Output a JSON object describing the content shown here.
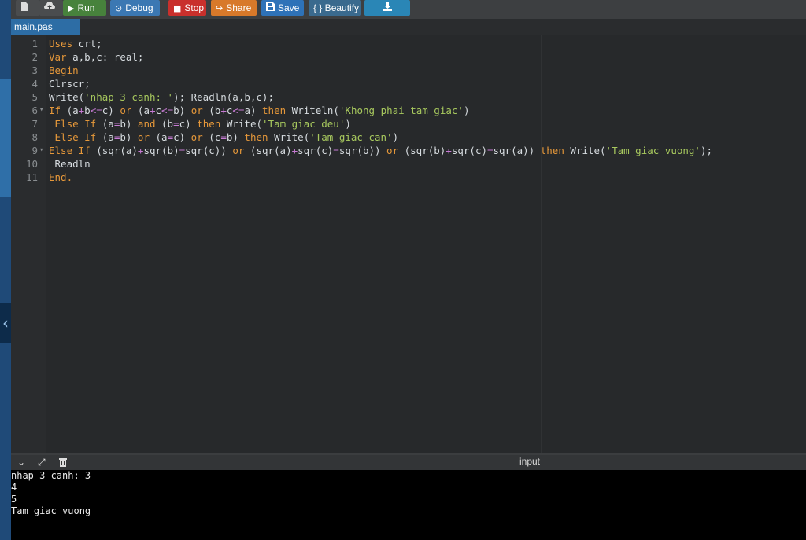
{
  "toolbar": {
    "buttons": [
      {
        "label": "",
        "icon": "file-icon",
        "color": "#4a4c4e"
      },
      {
        "label": "",
        "icon": "cloud-upload-icon",
        "color": "#4a4c4e"
      },
      {
        "label": "Run",
        "icon": "play-icon",
        "color": "#47823c"
      },
      {
        "label": "Debug",
        "icon": "debug-icon",
        "color": "#3b78b3"
      },
      {
        "label": "Stop",
        "icon": "stop-icon",
        "color": "#c9302c"
      },
      {
        "label": "Share",
        "icon": "share-icon",
        "color": "#d8792a"
      },
      {
        "label": "Save",
        "icon": "save-icon",
        "color": "#2e72b8"
      },
      {
        "label": "{ } Beautify",
        "icon": "",
        "color": "#3a6a8e"
      },
      {
        "label": "",
        "icon": "download-icon",
        "color": "#2a86b6"
      }
    ]
  },
  "editor": {
    "file_tab": "main.pas",
    "lines": [
      {
        "n": "1",
        "fold": "",
        "tokens": [
          [
            "kw",
            "Uses "
          ],
          [
            "t",
            "crt;"
          ]
        ]
      },
      {
        "n": "2",
        "fold": "",
        "tokens": [
          [
            "kw",
            "Var "
          ],
          [
            "t",
            "a,b,c: real;"
          ]
        ]
      },
      {
        "n": "3",
        "fold": "",
        "tokens": [
          [
            "kw",
            "Begin"
          ]
        ]
      },
      {
        "n": "4",
        "fold": "",
        "tokens": [
          [
            "t",
            "Clrscr;"
          ]
        ]
      },
      {
        "n": "5",
        "fold": "",
        "tokens": [
          [
            "t",
            "Write("
          ],
          [
            "str",
            "'nhap 3 canh: '"
          ],
          [
            "t",
            "); Readln(a,b,c);"
          ]
        ]
      },
      {
        "n": "6",
        "fold": "▾",
        "tokens": [
          [
            "kw",
            "If "
          ],
          [
            "t",
            "(a"
          ],
          [
            "op",
            "+"
          ],
          [
            "t",
            "b"
          ],
          [
            "op",
            "<="
          ],
          [
            "t",
            "c) "
          ],
          [
            "kw",
            "or "
          ],
          [
            "t",
            "(a"
          ],
          [
            "op",
            "+"
          ],
          [
            "t",
            "c"
          ],
          [
            "op",
            "<="
          ],
          [
            "t",
            "b) "
          ],
          [
            "kw",
            "or "
          ],
          [
            "t",
            "(b"
          ],
          [
            "op",
            "+"
          ],
          [
            "t",
            "c"
          ],
          [
            "op",
            "<="
          ],
          [
            "t",
            "a) "
          ],
          [
            "kw",
            "then "
          ],
          [
            "t",
            "Writeln("
          ],
          [
            "str",
            "'Khong phai tam giac'"
          ],
          [
            "t",
            ")"
          ]
        ]
      },
      {
        "n": "7",
        "fold": "",
        "tokens": [
          [
            "t",
            " "
          ],
          [
            "kw",
            "Else If "
          ],
          [
            "t",
            "(a"
          ],
          [
            "op",
            "="
          ],
          [
            "t",
            "b) "
          ],
          [
            "kw",
            "and "
          ],
          [
            "t",
            "(b"
          ],
          [
            "op",
            "="
          ],
          [
            "t",
            "c) "
          ],
          [
            "kw",
            "then "
          ],
          [
            "t",
            "Write("
          ],
          [
            "str",
            "'Tam giac deu'"
          ],
          [
            "t",
            ")"
          ]
        ]
      },
      {
        "n": "8",
        "fold": "",
        "tokens": [
          [
            "t",
            " "
          ],
          [
            "kw",
            "Else If "
          ],
          [
            "t",
            "(a"
          ],
          [
            "op",
            "="
          ],
          [
            "t",
            "b) "
          ],
          [
            "kw",
            "or "
          ],
          [
            "t",
            "(a"
          ],
          [
            "op",
            "="
          ],
          [
            "t",
            "c) "
          ],
          [
            "kw",
            "or "
          ],
          [
            "t",
            "(c"
          ],
          [
            "op",
            "="
          ],
          [
            "t",
            "b) "
          ],
          [
            "kw",
            "then "
          ],
          [
            "t",
            "Write("
          ],
          [
            "str",
            "'Tam giac can'"
          ],
          [
            "t",
            ")"
          ]
        ]
      },
      {
        "n": "9",
        "fold": "▾",
        "tokens": [
          [
            "kw",
            "Else If "
          ],
          [
            "t",
            "(sqr(a)"
          ],
          [
            "op",
            "+"
          ],
          [
            "t",
            "sqr(b)"
          ],
          [
            "op",
            "="
          ],
          [
            "t",
            "sqr(c)) "
          ],
          [
            "kw",
            "or "
          ],
          [
            "t",
            "(sqr(a)"
          ],
          [
            "op",
            "+"
          ],
          [
            "t",
            "sqr(c)"
          ],
          [
            "op",
            "="
          ],
          [
            "t",
            "sqr(b)) "
          ],
          [
            "kw",
            "or "
          ],
          [
            "t",
            "(sqr(b)"
          ],
          [
            "op",
            "+"
          ],
          [
            "t",
            "sqr(c)"
          ],
          [
            "op",
            "="
          ],
          [
            "t",
            "sqr(a)) "
          ],
          [
            "kw",
            "then "
          ],
          [
            "t",
            "Write("
          ],
          [
            "str",
            "'Tam giac vuong'"
          ],
          [
            "t",
            ");"
          ]
        ]
      },
      {
        "n": "10",
        "fold": "",
        "tokens": [
          [
            "t",
            " Readln"
          ]
        ]
      },
      {
        "n": "11",
        "fold": "",
        "tokens": [
          [
            "kw",
            "End."
          ]
        ]
      }
    ]
  },
  "output_panel": {
    "title": "input",
    "icons": [
      "chevron-down-icon",
      "expand-icon",
      "clear-icon"
    ],
    "console_lines": [
      "nhap 3 canh: 3",
      "4",
      "5",
      "Tam giac vuong"
    ]
  }
}
